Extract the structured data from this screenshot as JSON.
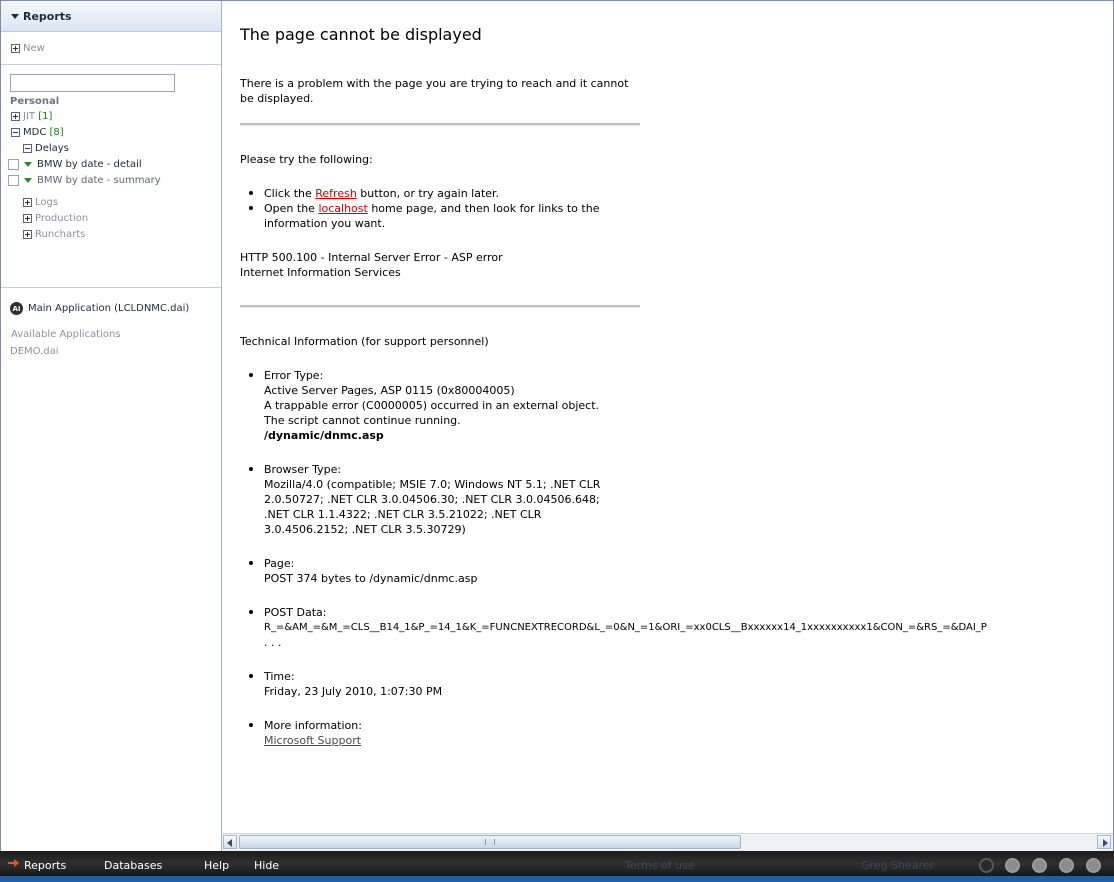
{
  "sidebar": {
    "header": "Reports",
    "new_label": "New",
    "search_placeholder": "",
    "section_personal": "Personal",
    "tree": {
      "jit": {
        "label": "JIT",
        "count": "[1]"
      },
      "mdc": {
        "label": "MDC",
        "count": "[8]"
      },
      "delays": "Delays",
      "report1": "BMW by date - detail",
      "report2": "BMW by date - summary",
      "logs": "Logs",
      "production": "Production",
      "runcharts": "Runcharts"
    },
    "app_badge": "AI",
    "main_app": "Main Application (LCLDNMC.dai)",
    "available_label": "Available Applications",
    "demo_app": "DEMO.dai"
  },
  "error_page": {
    "title": "The page cannot be displayed",
    "intro": "There is a problem with the page you are trying to reach and it cannot be displayed.",
    "try_following": "Please try the following:",
    "bullet1": {
      "pre": "Click the ",
      "link": "Refresh",
      "post": " button, or try again later."
    },
    "bullet2": {
      "pre": "Open the ",
      "link": "localhost",
      "post": " home page, and then look for links to the information you want."
    },
    "http_error": "HTTP 500.100 - Internal Server Error - ASP error",
    "iis": "Internet Information Services",
    "tech_heading": "Technical Information (for support personnel)",
    "error_type": {
      "label": "Error Type:",
      "line1": "Active Server Pages, ASP 0115 (0x80004005)",
      "line2": "A trappable error (C0000005) occurred in an external object.",
      "line3": "The script cannot continue running.",
      "file": "/dynamic/dnmc.asp"
    },
    "browser_type": {
      "label": "Browser Type:",
      "value": "Mozilla/4.0 (compatible; MSIE 7.0; Windows NT 5.1; .NET CLR 2.0.50727; .NET CLR 3.0.04506.30; .NET CLR 3.0.04506.648; .NET CLR 1.1.4322; .NET CLR 3.5.21022; .NET CLR 3.0.4506.2152; .NET CLR 3.5.30729)"
    },
    "page_info": {
      "label": "Page:",
      "value": "POST 374 bytes to /dynamic/dnmc.asp"
    },
    "post_data": {
      "label": "POST Data:",
      "value": "R_=&AM_=&M_=CLS__B14_1&P_=14_1&K_=FUNCNEXTRECORD&L_=0&N_=1&ORI_=xx0CLS__Bxxxxxx14_1xxxxxxxxxx1&CON_=&RS_=&DAI_P",
      "ellipsis": ". . ."
    },
    "time": {
      "label": "Time:",
      "value": "Friday, 23 July 2010, 1:07:30 PM"
    },
    "more_info": {
      "label": "More information:",
      "link": "Microsoft Support"
    }
  },
  "taskbar": {
    "reports": "Reports",
    "databases": "Databases",
    "help": "Help",
    "hide": "Hide",
    "terms": "Terms of use",
    "user": "Greg Shearer"
  },
  "colors": {
    "link_red": "#cc0000",
    "count_green": "#208020",
    "taskbar_bg": "#1b1b1b",
    "accent_orange": "#e8541c"
  }
}
